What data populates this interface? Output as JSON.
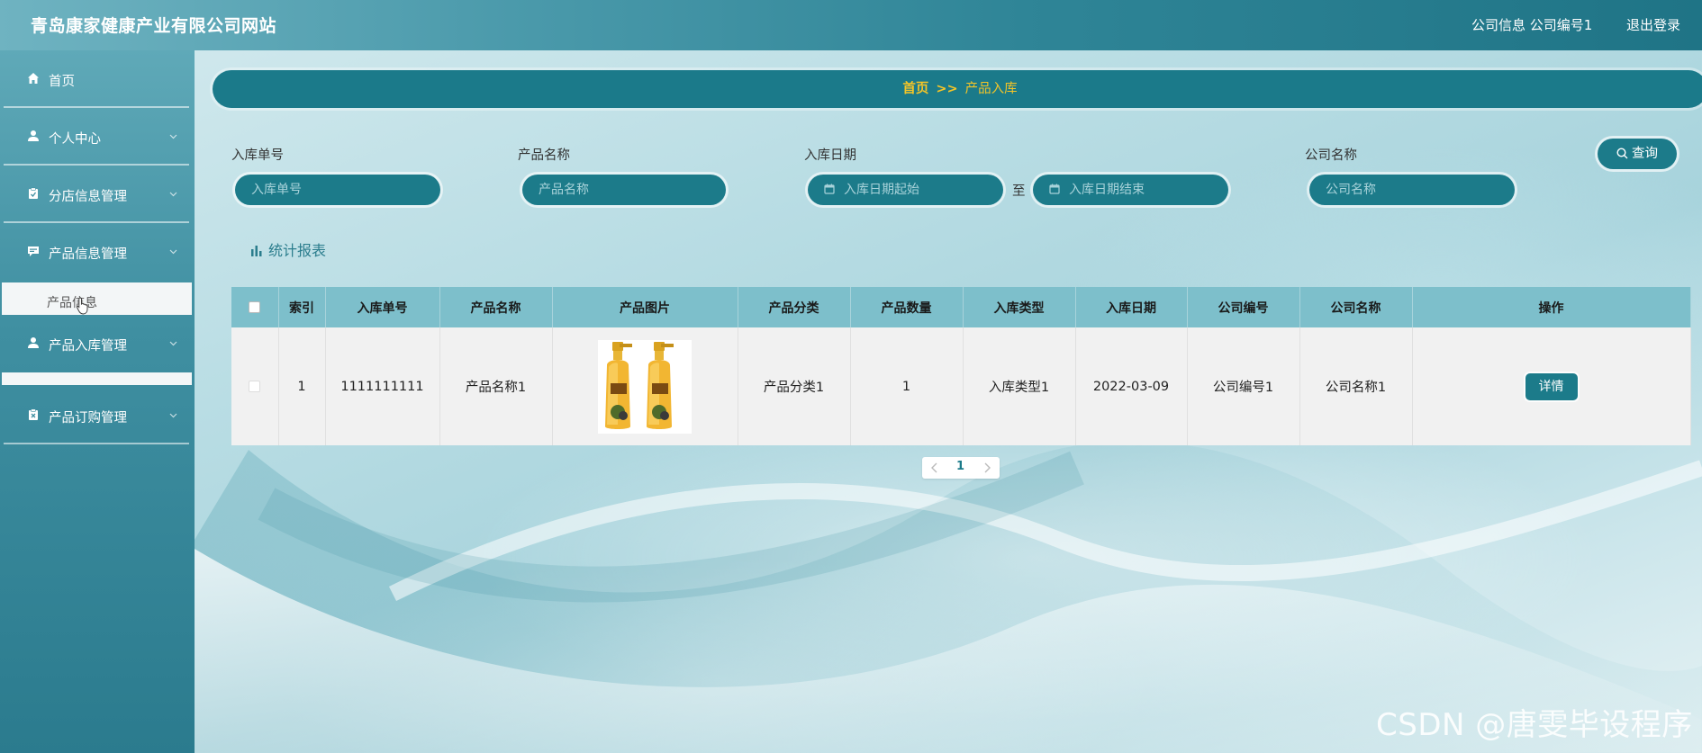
{
  "header": {
    "site_title": "青岛康家健康产业有限公司网站",
    "user_info": "公司信息 公司编号1",
    "logout": "退出登录"
  },
  "sidebar": {
    "items": [
      {
        "label": "首页",
        "icon": "home-icon"
      },
      {
        "label": "个人中心",
        "icon": "user-icon"
      },
      {
        "label": "分店信息管理",
        "icon": "clipboard-icon"
      },
      {
        "label": "产品信息管理",
        "icon": "message-icon"
      },
      {
        "label": "产品入库管理",
        "icon": "user-icon"
      },
      {
        "label": "产品订购管理",
        "icon": "clipboard-x-icon"
      }
    ],
    "submenu_label": "产品信息"
  },
  "breadcrumb": {
    "home": "首页",
    "separator": ">>",
    "current": "产品入库"
  },
  "search": {
    "entry_no_label": "入库单号",
    "entry_no_placeholder": "入库单号",
    "product_name_label": "产品名称",
    "product_name_placeholder": "产品名称",
    "date_label": "入库日期",
    "date_start_placeholder": "入库日期起始",
    "date_range_sep": "至",
    "date_end_placeholder": "入库日期结束",
    "company_name_label": "公司名称",
    "company_name_placeholder": "公司名称",
    "query_button": "查询"
  },
  "stats_link": "统计报表",
  "table": {
    "headers": [
      "索引",
      "入库单号",
      "产品名称",
      "产品图片",
      "产品分类",
      "产品数量",
      "入库类型",
      "入库日期",
      "公司编号",
      "公司名称",
      "操作"
    ],
    "rows": [
      {
        "index": "1",
        "entry_no": "1111111111",
        "product_name": "产品名称1",
        "category": "产品分类1",
        "quantity": "1",
        "entry_type": "入库类型1",
        "entry_date": "2022-03-09",
        "company_no": "公司编号1",
        "company_name": "公司名称1",
        "action": "详情"
      }
    ]
  },
  "pagination": {
    "current_page": "1"
  },
  "watermark": "CSDN @唐雯毕设程序",
  "colors": {
    "primary": "#1c7b8a",
    "breadcrumb_text": "#f5c527",
    "table_header": "#7dbfcb"
  }
}
